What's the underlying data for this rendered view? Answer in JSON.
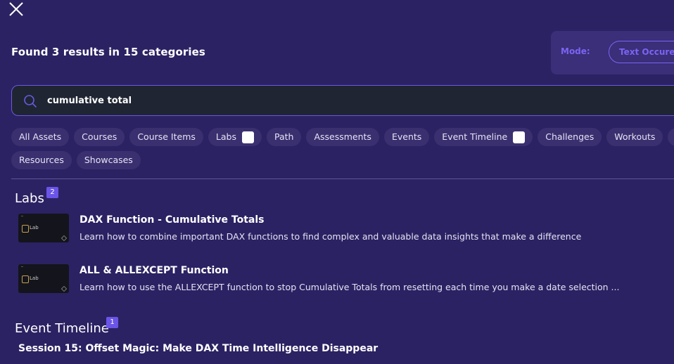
{
  "header": {
    "close_icon": "close-icon",
    "result_summary": "Found 3 results in 15 categories"
  },
  "mode": {
    "label": "Mode:",
    "selected": "Text Occurences"
  },
  "search": {
    "query": "cumulative total",
    "icon": "search-icon"
  },
  "filters": {
    "row1": [
      {
        "label": "All Assets",
        "checkbox": false
      },
      {
        "label": "Courses",
        "checkbox": false
      },
      {
        "label": "Course Items",
        "checkbox": false
      },
      {
        "label": "Labs",
        "checkbox": true
      },
      {
        "label": "Path",
        "checkbox": false
      },
      {
        "label": "Assessments",
        "checkbox": false
      },
      {
        "label": "Events",
        "checkbox": false
      },
      {
        "label": "Event Timeline",
        "checkbox": true
      },
      {
        "label": "Challenges",
        "checkbox": false
      },
      {
        "label": "Workouts",
        "checkbox": false
      },
      {
        "label": "Wo",
        "checkbox": false
      }
    ],
    "row2": [
      {
        "label": "Resources",
        "checkbox": false
      },
      {
        "label": "Showcases",
        "checkbox": false
      }
    ]
  },
  "sections": {
    "labs": {
      "title": "Labs",
      "count": "2",
      "items": [
        {
          "title": "DAX Function - Cumulative Totals",
          "description": "Learn how to combine important DAX functions to find complex and valuable data insights that make a difference",
          "thumb_label": "Lab"
        },
        {
          "title": "ALL & ALLEXCEPT Function",
          "description": "Learn how to use the ALLEXCEPT function to stop Cumulative Totals from resetting each time you make a date selection ...",
          "thumb_label": "Lab"
        }
      ]
    },
    "event_timeline": {
      "title": "Event Timeline",
      "count": "1",
      "items": [
        {
          "title": "Session 15: Offset Magic: Make DAX Time Intelligence Disappear"
        }
      ]
    }
  },
  "colors": {
    "background": "#2b2263",
    "accent": "#7b64f2",
    "badge": "#6a55e8",
    "search_bg": "#1f2533"
  }
}
